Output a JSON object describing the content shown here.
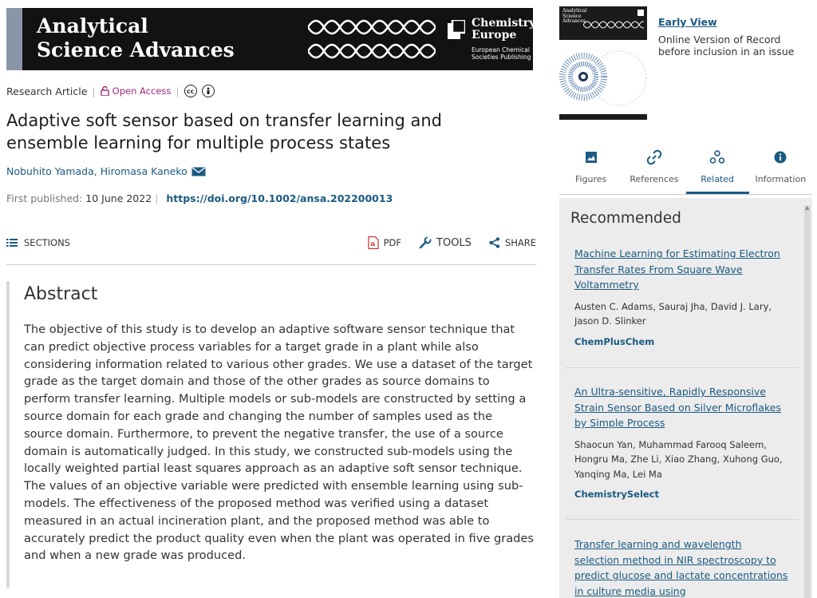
{
  "header": {
    "journal_line1": "Analytical",
    "journal_line2": "Science Advances",
    "publisher_name_line1": "Chemistry",
    "publisher_name_line2": "Europe",
    "publisher_sub_line1": "European Chemical",
    "publisher_sub_line2": "Societies Publishing"
  },
  "article": {
    "type": "Research Article",
    "open_access": "Open Access",
    "license_icons": [
      "cc-icon",
      "by-icon"
    ],
    "title": "Adaptive soft sensor based on transfer learning and ensemble learning for multiple process states",
    "authors": "Nobuhito Yamada,  Hiromasa Kaneko",
    "published_label": "First published:",
    "published_date": "10 June 2022",
    "doi": "https://doi.org/10.1002/ansa.202200013"
  },
  "toolbar": {
    "sections": "SECTIONS",
    "pdf": "PDF",
    "tools": "TOOLS",
    "share": "SHARE"
  },
  "abstract": {
    "heading": "Abstract",
    "body": "The objective of this study is to develop an adaptive software sensor technique that can predict objective process variables for a target grade in a plant while also considering information related to various other grades. We use a dataset of the target grade as the target domain and those of the other grades as source domains to perform transfer learning. Multiple models or sub-models are constructed by setting a source domain for each grade and changing the number of samples used as the source domain. Furthermore, to prevent the negative transfer, the use of a source domain is automatically judged. In this study, we constructed sub-models using the locally weighted partial least squares approach as an adaptive soft sensor technique. The values of an objective variable were predicted with ensemble learning using sub-models. The effectiveness of the proposed method was verified using a dataset measured in an actual incineration plant, and the proposed method was able to accurately predict the product quality even when the plant was operated in five grades and when a new grade was produced."
  },
  "sidebar": {
    "cover_title_line1": "Analytical",
    "cover_title_line2": "Science",
    "cover_title_line3": "Advances",
    "early_view": "Early View",
    "early_view_desc": "Online Version of Record before inclusion in an issue",
    "tabs": [
      {
        "label": "Figures",
        "icon": "image-icon"
      },
      {
        "label": "References",
        "icon": "link-icon"
      },
      {
        "label": "Related",
        "icon": "related-icon",
        "active": true
      },
      {
        "label": "Information",
        "icon": "info-icon"
      }
    ],
    "recommended_heading": "Recommended",
    "recommended": [
      {
        "title": "Machine Learning for Estimating Electron Transfer Rates From Square Wave Voltammetry",
        "authors": "Austen C. Adams, Sauraj Jha, David J. Lary, Jason D. Slinker",
        "journal": "ChemPlusChem"
      },
      {
        "title": "An Ultra-sensitive, Rapidly Responsive Strain Sensor Based on Silver Microflakes by Simple Process",
        "authors": "Shaocun Yan, Muhammad Farooq Saleem, Hongru Ma, Zhe Li, Xiao Zhang, Xuhong Guo, Yanqing Ma, Lei Ma",
        "journal": "ChemistrySelect"
      },
      {
        "title": "Transfer learning and wavelength selection method in NIR spectroscopy to predict glucose and lactate concentrations in culture media using"
      }
    ]
  }
}
